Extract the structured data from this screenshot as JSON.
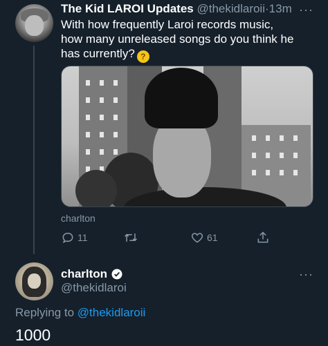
{
  "tweet": {
    "author_name": "The Kid LAROI Updates",
    "author_handle": "@thekidlaroii",
    "separator": "·",
    "time": "13m",
    "more": "···",
    "text": "With how frequently Laroi records music, how many unreleased songs do you think he has currently?",
    "emoji_name": "thinking-face",
    "photo_caption": "charlton",
    "replies": "11",
    "retweets": "",
    "likes": "61"
  },
  "reply": {
    "author_name": "charlton",
    "author_handle": "@thekidlaroi",
    "more": "···",
    "replying_prefix": "Replying to",
    "replying_to": "@thekidlaroii",
    "text": "1000"
  },
  "colors": {
    "background": "#15202b",
    "secondary_text": "#8899a6",
    "link": "#1d9bf0",
    "divider": "#38444d"
  }
}
